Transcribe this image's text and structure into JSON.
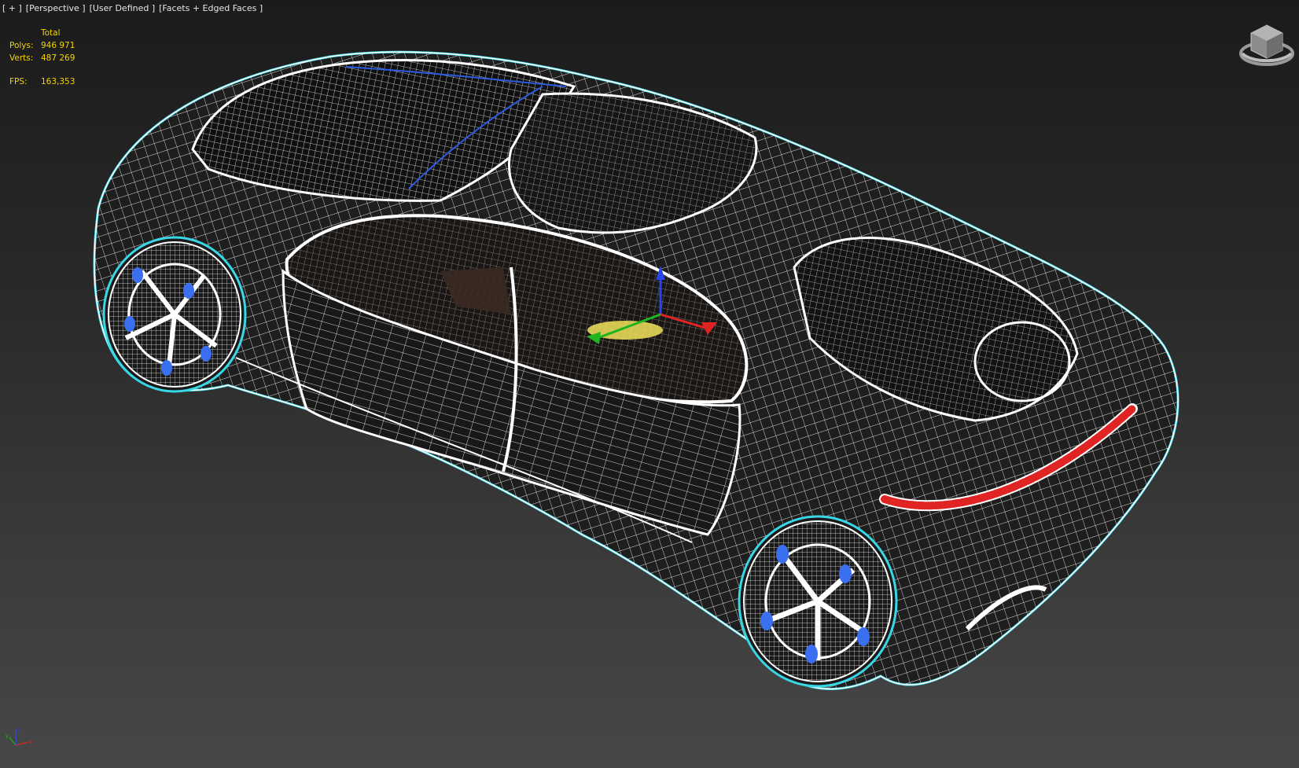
{
  "viewport": {
    "menu": {
      "plus": "[ + ]",
      "view": "[Perspective ]",
      "preset": "[User Defined ]",
      "shading": "[Facets + Edged Faces ]"
    },
    "stats": {
      "column_header": "Total",
      "polys_label": "Polys:",
      "polys_value": "946 971",
      "verts_label": "Verts:",
      "verts_value": "487 269",
      "fps_label": "FPS:",
      "fps_value": "163,353"
    },
    "axis_labels": {
      "x": "x",
      "y": "y",
      "z": "z"
    }
  },
  "colors": {
    "selection_outline": "#39d6e6",
    "wire": "#ffffff",
    "body": "#1e1e1e",
    "tail_light": "#e02424",
    "stats_text": "#f2d500",
    "rim_accent": "#3a6ff0",
    "gizmo_x": "#e02424",
    "gizmo_y": "#1fb51f",
    "gizmo_z": "#2846e6",
    "gizmo_plane": "#f2e35a"
  },
  "icons": [
    "viewcube-icon",
    "axis-tripod-icon",
    "transform-gizmo-icon"
  ]
}
